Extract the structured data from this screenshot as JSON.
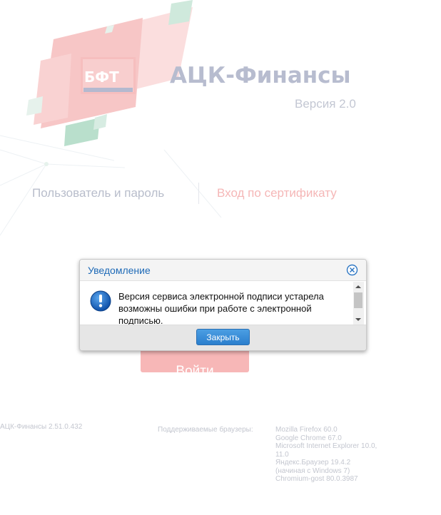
{
  "logo": {
    "brand_text": "БФТ",
    "app_title": "АЦК-Финансы",
    "version": "Версия 2.0"
  },
  "login_tabs": {
    "user_password": "Пользователь и пароль",
    "certificate": "Вход по сертификату"
  },
  "login_button_label": "Войти",
  "dialog": {
    "title": "Уведомление",
    "message": "Версия сервиса электронной подписи устарела возможны ошибки при работе с электронной подписью.",
    "close_button_label": "Закрыть",
    "accent_color": "#1e6ab7"
  },
  "footer": {
    "build_version": "АЦК-Финансы 2.51.0.432",
    "browsers_label": "Поддерживаемые браузеры:",
    "browsers": [
      "Mozilla Firefox 60.0",
      "Google Chrome 67.0",
      "Microsoft Internet Explorer 10.0,",
      "11.0",
      "Яндекс.Браузер 19.4.2",
      "(начиная с Windows 7)",
      "Chromium-gost 80.0.3987"
    ]
  },
  "icons": {
    "dialog_close": "close-circle-icon",
    "dialog_info": "info-icon"
  }
}
